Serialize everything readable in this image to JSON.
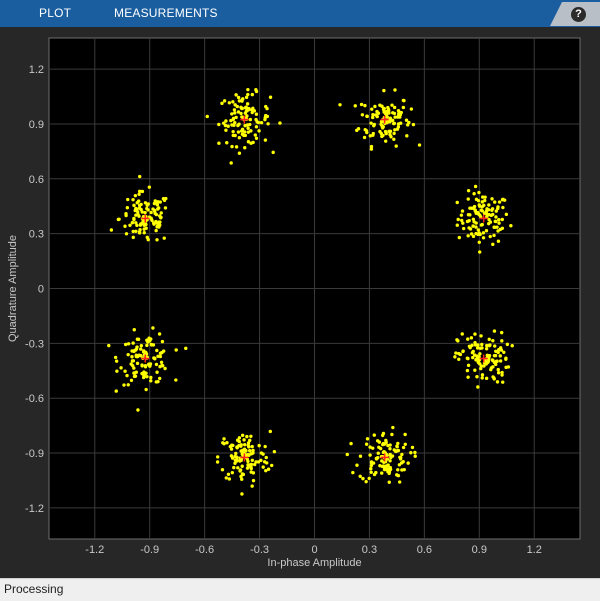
{
  "toolstrip": {
    "tabs": [
      {
        "label": "PLOT"
      },
      {
        "label": "MEASUREMENTS"
      }
    ],
    "help_label": "?"
  },
  "status": {
    "text": "Processing"
  },
  "colors": {
    "toolstrip": "#1a5ea0",
    "plot_bg": "#000000",
    "grid": "#3a3a3a",
    "points": "#ffff00",
    "reference": "#ff2020"
  },
  "chart_data": {
    "type": "scatter",
    "xlabel": "In-phase Amplitude",
    "ylabel": "Quadrature Amplitude",
    "xlim": [
      -1.45,
      1.45
    ],
    "ylim": [
      -1.37,
      1.37
    ],
    "xticks": [
      -1.2,
      -0.9,
      -0.6,
      -0.3,
      0,
      0.3,
      0.6,
      0.9,
      1.2
    ],
    "yticks": [
      1.2,
      0.9,
      0.6,
      0.3,
      0,
      -0.3,
      -0.6,
      -0.9,
      -1.2
    ],
    "grid": true,
    "reference_constellation": [
      [
        0.924,
        0.383
      ],
      [
        0.383,
        0.924
      ],
      [
        -0.383,
        0.924
      ],
      [
        -0.924,
        0.383
      ],
      [
        -0.924,
        -0.383
      ],
      [
        -0.383,
        -0.924
      ],
      [
        0.383,
        -0.924
      ],
      [
        0.924,
        -0.383
      ]
    ],
    "cluster_spread": 0.07,
    "points_per_cluster": 110
  }
}
